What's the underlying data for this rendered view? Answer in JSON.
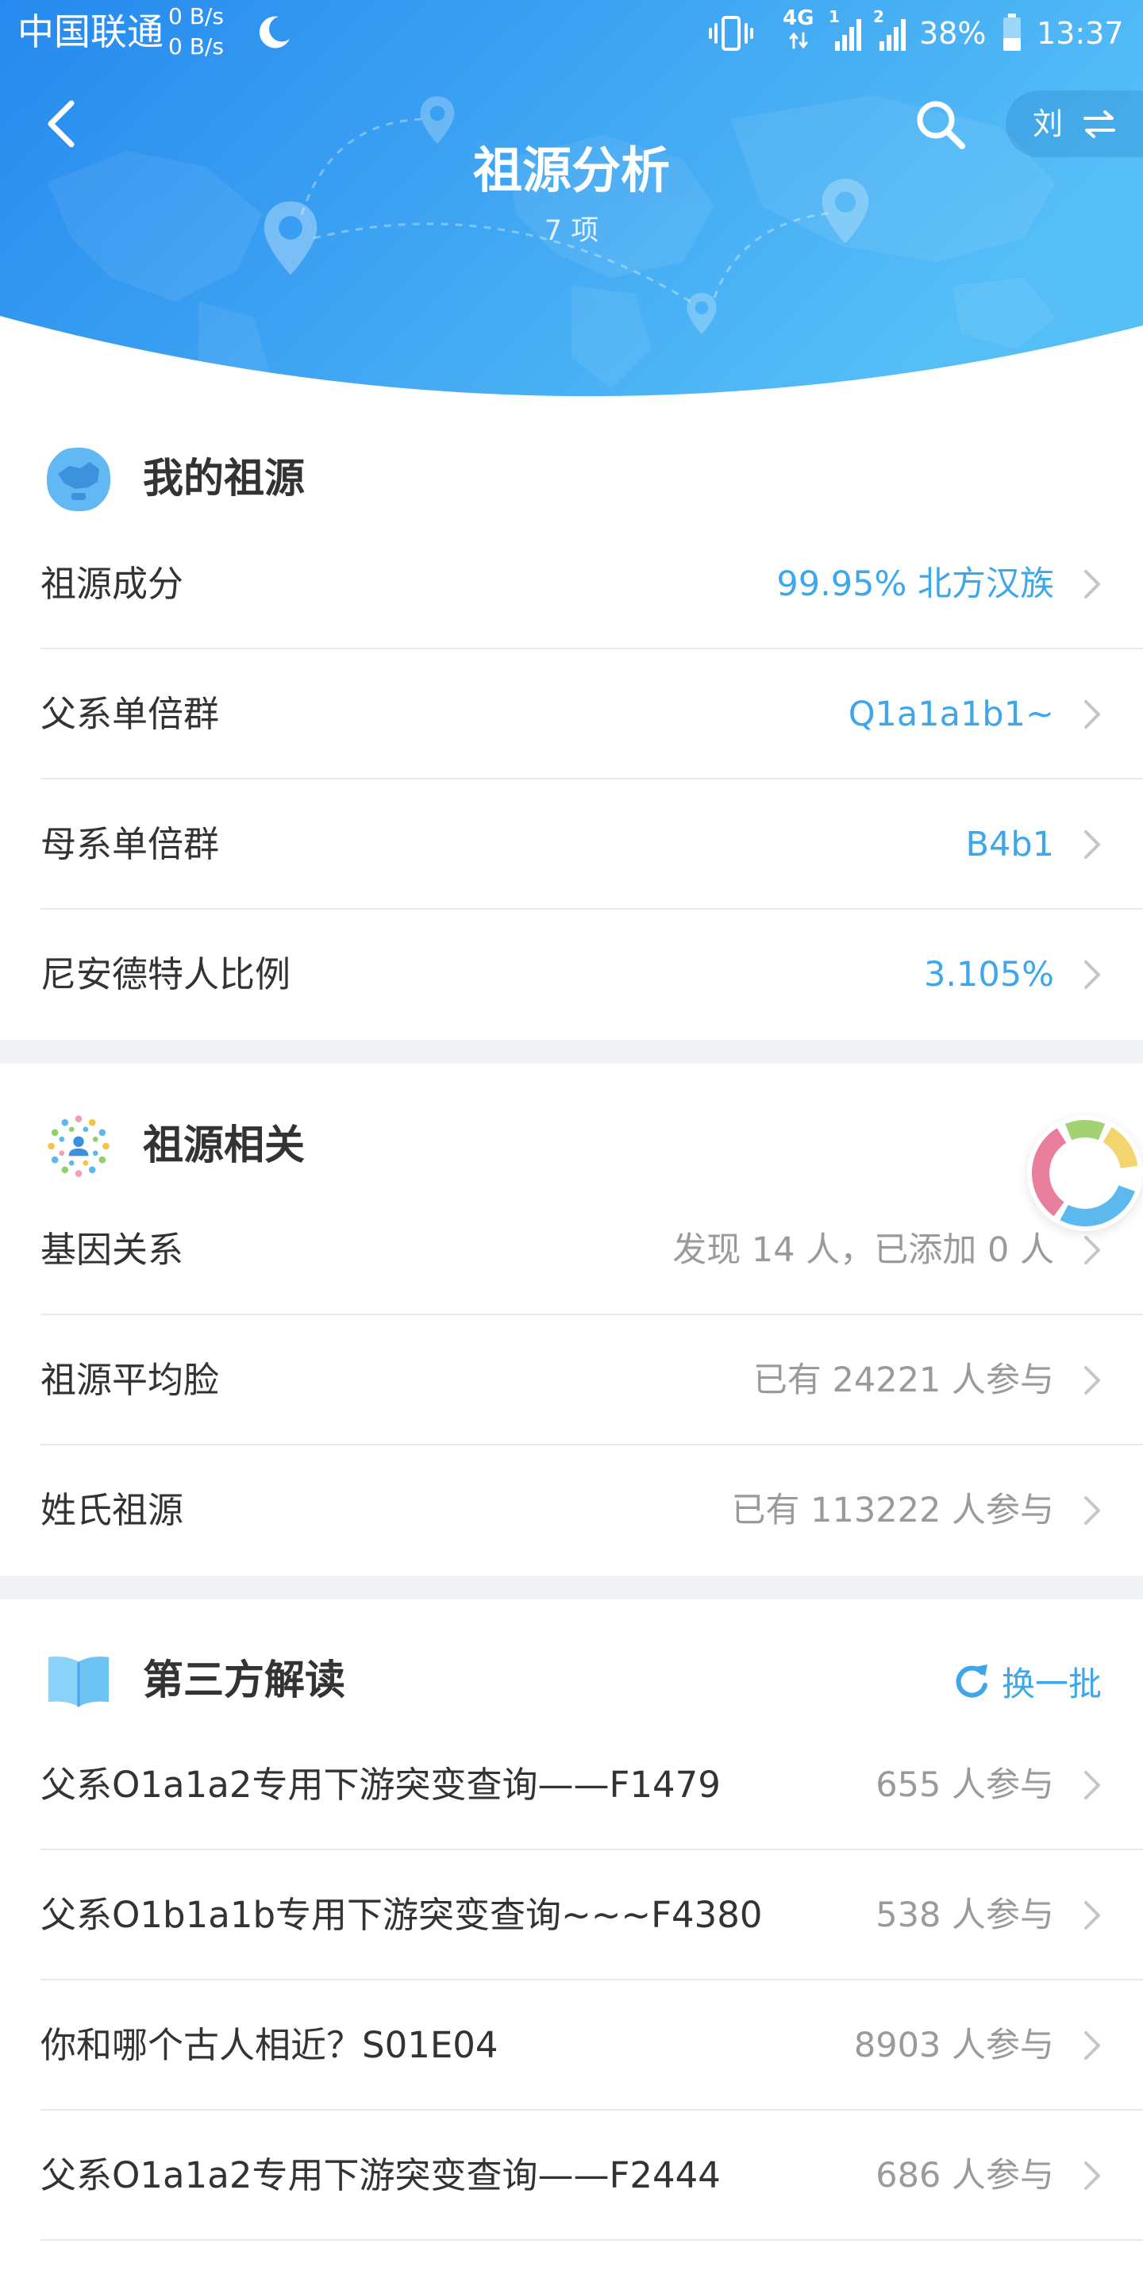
{
  "status_bar": {
    "carrier": "中国联通",
    "net_speed_up": "0 B/s",
    "net_speed_down": "0 B/s",
    "network_type": "4G",
    "sim1_label": "1",
    "sim2_label": "2",
    "battery_text": "38%",
    "battery_level": 0.38,
    "time": "13:37"
  },
  "header": {
    "title": "祖源分析",
    "subtitle": "7 项",
    "user_switch_label": "刘"
  },
  "sections": [
    {
      "title": "我的祖源",
      "rows": [
        {
          "label": "祖源成分",
          "value": "99.95% 北方汉族"
        },
        {
          "label": "父系单倍群",
          "value": "Q1a1a1b1~"
        },
        {
          "label": "母系单倍群",
          "value": "B4b1"
        },
        {
          "label": "尼安德特人比例",
          "value": "3.105%"
        }
      ]
    },
    {
      "title": "祖源相关",
      "rows": [
        {
          "label": "基因关系",
          "value": "发现 14 人，已添加 0 人"
        },
        {
          "label": "祖源平均脸",
          "value": "已有 24221 人参与"
        },
        {
          "label": "姓氏祖源",
          "value": "已有 113222 人参与"
        }
      ]
    },
    {
      "title": "第三方解读",
      "action_label": "换一批",
      "rows": [
        {
          "label": "父系O1a1a2专用下游突变查询——F1479",
          "value": "655 人参与"
        },
        {
          "label": "父系O1b1a1b专用下游突变查询~~~F4380",
          "value": "538 人参与"
        },
        {
          "label": "你和哪个古人相近？S01E04",
          "value": "8903 人参与"
        },
        {
          "label": "父系O1a1a2专用下游突变查询——F2444",
          "value": "686 人参与"
        }
      ]
    }
  ],
  "theme": {
    "accent": "#3ea6ea",
    "muted": "#9a9a9a",
    "text": "#333333",
    "grad-a": "#2689ee",
    "grad-b": "#55bef7",
    "ring-blue": "#5cb9ee",
    "ring-pink": "#e97f9d",
    "ring-green": "#a3d173",
    "ring-yellow": "#f4d46c"
  }
}
